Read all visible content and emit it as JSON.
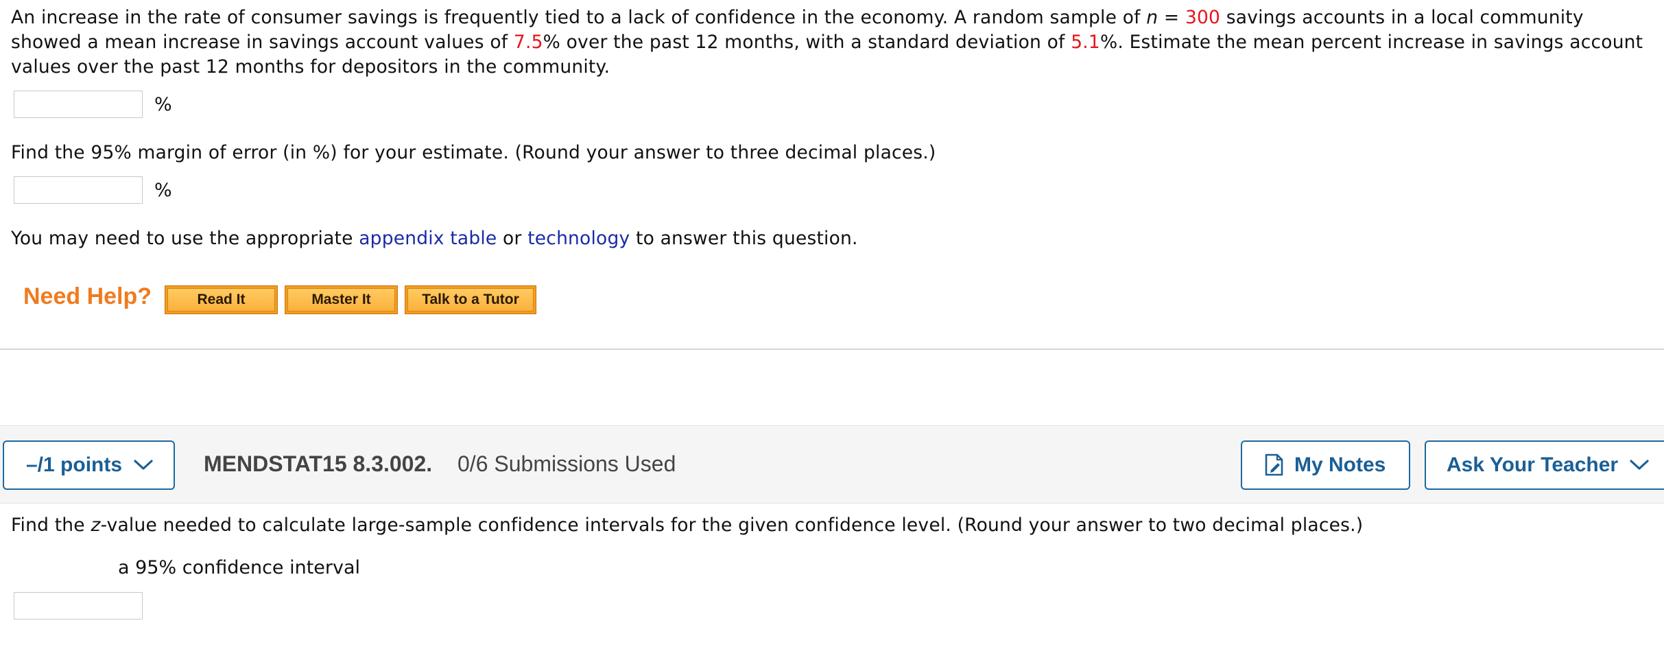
{
  "question1": {
    "text_1": "An increase in the rate of consumer savings is frequently tied to a lack of confidence in the economy. A random sample of ",
    "n_var": "n",
    "equals": " = ",
    "n_value": "300",
    "text_2": " savings accounts in a local community showed a mean increase in savings account values of ",
    "mean_value": "7.5",
    "text_3": "% over the past 12 months, with a standard deviation of ",
    "sd_value": "5.1",
    "text_4": "%. Estimate the mean percent increase in savings account values over the past 12 months for depositors in the community.",
    "answer1_value": "",
    "unit1": "%",
    "margin_prompt": "Find the 95% margin of error (in %) for your estimate. (Round your answer to three decimal places.)",
    "answer2_value": "",
    "unit2": "%",
    "hint_1": "You may need to use the appropriate ",
    "hint_link_1": "appendix table",
    "hint_2": " or ",
    "hint_link_2": "technology",
    "hint_3": " to answer this question."
  },
  "help": {
    "label": "Need Help?",
    "read_it": "Read It",
    "master_it": "Master It",
    "talk_tutor": "Talk to a Tutor"
  },
  "question2_header": {
    "points": "–/1 points",
    "code": "MENDSTAT15 8.3.002.",
    "submissions": "0/6 Submissions Used",
    "my_notes": "My Notes",
    "ask_teacher": "Ask Your Teacher"
  },
  "question2": {
    "text_1": "Find the ",
    "z_var": "z",
    "text_2": "-value needed to calculate large-sample confidence intervals for the given confidence level. (Round your answer to two decimal places.)",
    "sub_label": "a 95% confidence interval",
    "answer_value": ""
  },
  "colors": {
    "highlight": "#e8141b",
    "link": "#1b2aa8",
    "accent_blue": "#1a6aa2",
    "need_help_orange": "#f07b1e",
    "button_orange": "#fbb13b"
  }
}
